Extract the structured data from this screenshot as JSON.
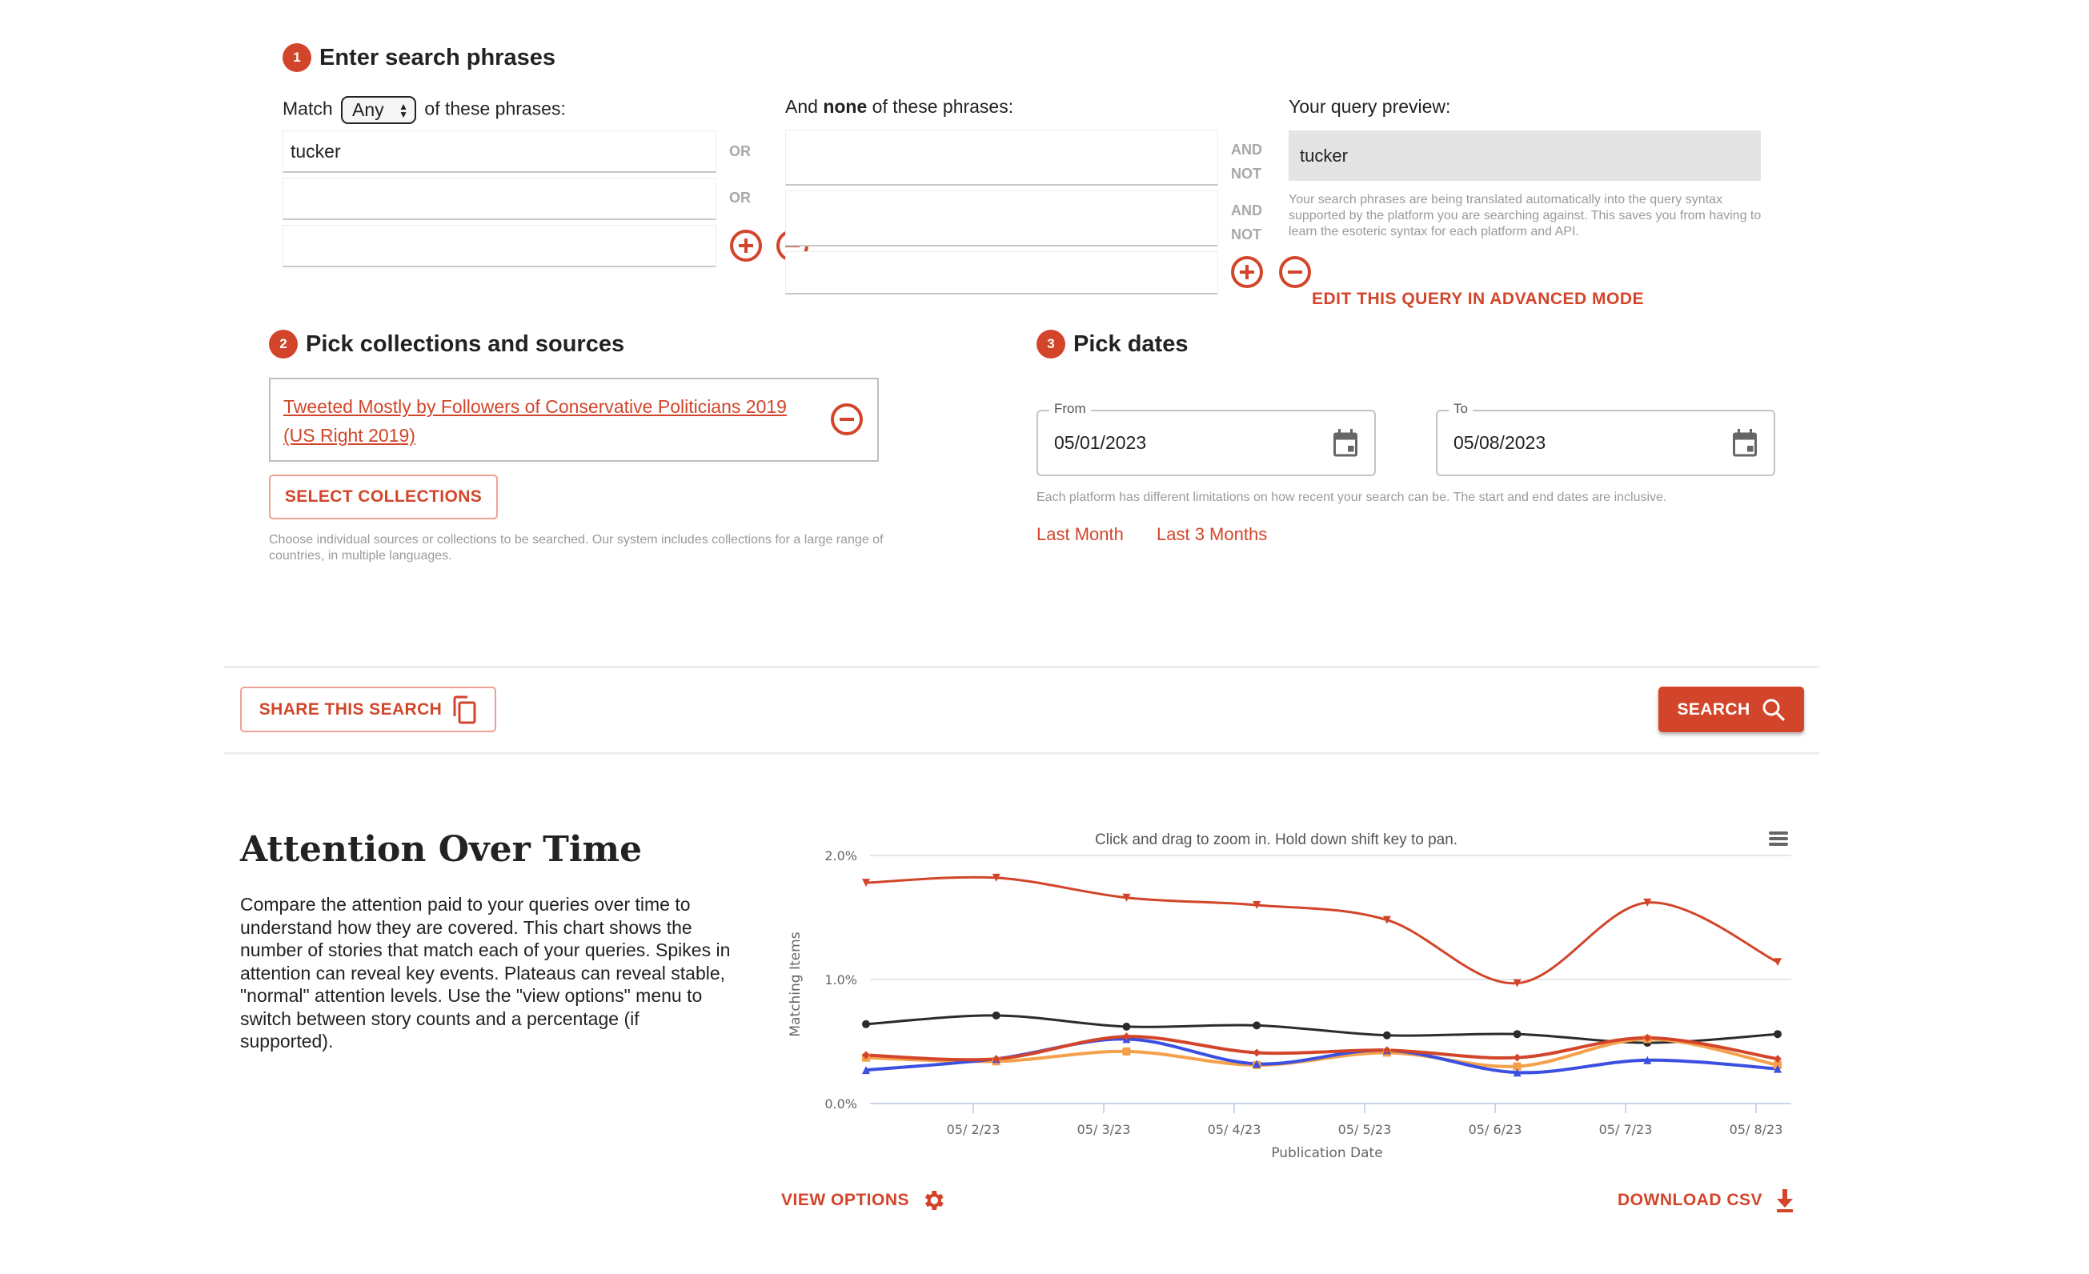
{
  "step1": {
    "badge": "1",
    "title": "Enter search phrases",
    "match_prefix": "Match",
    "match_select_value": "Any",
    "match_suffix": "of these phrases:",
    "any_inputs": [
      "tucker",
      "",
      ""
    ],
    "or_label": "OR",
    "none_label_prefix": "And",
    "none_label_bold": "none",
    "none_label_suffix": "of these phrases:",
    "none_inputs": [
      "",
      "",
      ""
    ],
    "and_label": "AND",
    "not_label": "NOT",
    "preview_label": "Your query preview:",
    "preview_value": "tucker",
    "preview_help": "Your search phrases are being translated automatically into the query syntax supported by the platform you are searching against. This saves you from having to learn the esoteric syntax for each platform and API.",
    "advanced_mode_link": "EDIT THIS QUERY IN ADVANCED MODE"
  },
  "step2": {
    "badge": "2",
    "title": "Pick collections and sources",
    "selected_collections": [
      "Tweeted Mostly by Followers of Conservative Politicians 2019 (US Right 2019)"
    ],
    "select_button": "SELECT COLLECTIONS",
    "help": "Choose individual sources or collections to be searched. Our system includes collections for a large range of countries, in multiple languages."
  },
  "step3": {
    "badge": "3",
    "title": "Pick dates",
    "from_label": "From",
    "from_value": "05/01/2023",
    "to_label": "To",
    "to_value": "05/08/2023",
    "help": "Each platform has different limitations on how recent your search can be. The start and end dates are inclusive.",
    "quick_links": [
      "Last Month",
      "Last 3 Months"
    ]
  },
  "actions": {
    "share_button": "SHARE THIS SEARCH",
    "search_button": "SEARCH"
  },
  "attention": {
    "title": "Attention Over Time",
    "description": "Compare the attention paid to your queries over time to understand how they are covered. This chart shows the number of stories that match each of your queries. Spikes in attention can reveal key events. Plateaus can reveal stable, \"normal\" attention levels. Use the \"view options\" menu to switch between story counts and a percentage (if supported).",
    "chart_hint": "Click and drag to zoom in. Hold down shift key to pan.",
    "view_options": "VIEW OPTIONS",
    "download_csv": "DOWNLOAD CSV"
  },
  "colors": {
    "accent": "#d2452a",
    "series_red": "#d2452a",
    "series_black": "#2b2b2b",
    "series_blue": "#3b4fe0",
    "series_orange": "#f5a04a"
  },
  "chart_data": {
    "type": "line",
    "title": "",
    "subtitle": "Click and drag to zoom in. Hold down shift key to pan.",
    "xlabel": "Publication Date",
    "ylabel": "Matching Items",
    "x_ticks": [
      "05/ 2/23",
      "05/ 3/23",
      "05/ 4/23",
      "05/ 5/23",
      "05/ 6/23",
      "05/ 7/23",
      "05/ 8/23"
    ],
    "y_ticks": [
      "0.0%",
      "1.0%",
      "2.0%"
    ],
    "ylim": [
      0,
      2.0
    ],
    "y_unit": "%",
    "x": [
      "05/01/23",
      "05/02/23",
      "05/03/23",
      "05/04/23",
      "05/05/23",
      "05/06/23",
      "05/07/23",
      "05/08/23"
    ],
    "grid": true,
    "legend": "none",
    "series": [
      {
        "name": "series-red-top",
        "color": "#d2452a",
        "marker": "triangle-down",
        "values": [
          1.78,
          1.82,
          1.66,
          1.6,
          1.48,
          0.97,
          1.62,
          1.14
        ]
      },
      {
        "name": "series-black",
        "color": "#2b2b2b",
        "marker": "circle",
        "values": [
          0.64,
          0.71,
          0.62,
          0.63,
          0.55,
          0.56,
          0.49,
          0.56
        ]
      },
      {
        "name": "series-red-lower",
        "color": "#d2452a",
        "marker": "diamond",
        "values": [
          0.39,
          0.36,
          0.54,
          0.41,
          0.43,
          0.37,
          0.53,
          0.36
        ]
      },
      {
        "name": "series-orange",
        "color": "#f5a04a",
        "marker": "square",
        "values": [
          0.37,
          0.34,
          0.42,
          0.31,
          0.41,
          0.3,
          0.52,
          0.31
        ]
      },
      {
        "name": "series-blue",
        "color": "#3b4fe0",
        "marker": "triangle",
        "values": [
          0.27,
          0.36,
          0.52,
          0.32,
          0.43,
          0.25,
          0.35,
          0.28
        ]
      }
    ]
  }
}
